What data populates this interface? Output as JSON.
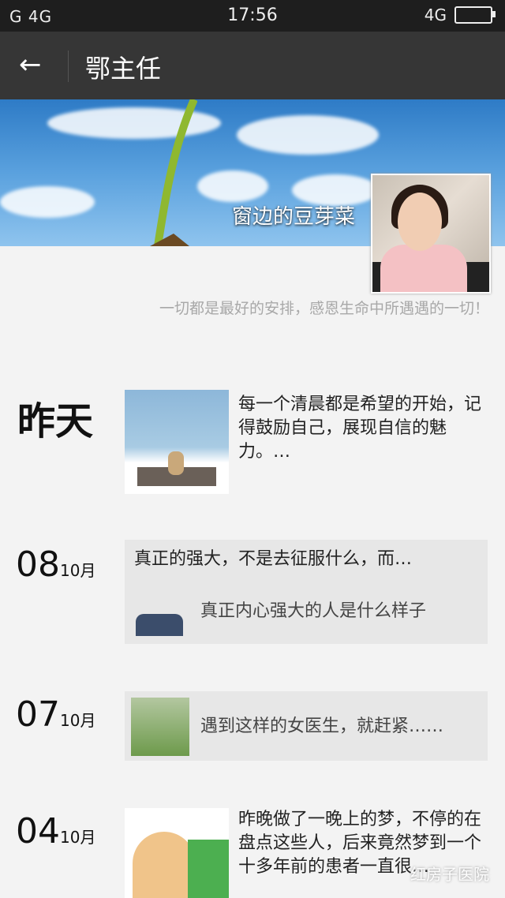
{
  "status_bar": {
    "left": "G 4G",
    "time": "17:56",
    "right": "4G"
  },
  "app_bar": {
    "back_icon": "arrow-left-icon",
    "title": "鄂主任"
  },
  "profile": {
    "nickname": "窗边的豆芽菜",
    "signature": "一切都是最好的安排，感恩生命中所遇遇的一切！"
  },
  "posts": [
    {
      "date_label": "昨天",
      "text": "每一个清晨都是希望的开始，记得鼓励自己，展现自信的魅力。…"
    },
    {
      "day": "08",
      "month": "10月",
      "title": "真正的强大，不是去征服什么，而…",
      "link_text": "真正内心强大的人是什么样子"
    },
    {
      "day": "07",
      "month": "10月",
      "link_text": "遇到这样的女医生，就赶紧……"
    },
    {
      "day": "04",
      "month": "10月",
      "text": "昨晚做了一晚上的梦，不停的在盘点这些人，后来竟然梦到一个十多年前的患者一直很…"
    }
  ],
  "watermark": "红房子医院"
}
